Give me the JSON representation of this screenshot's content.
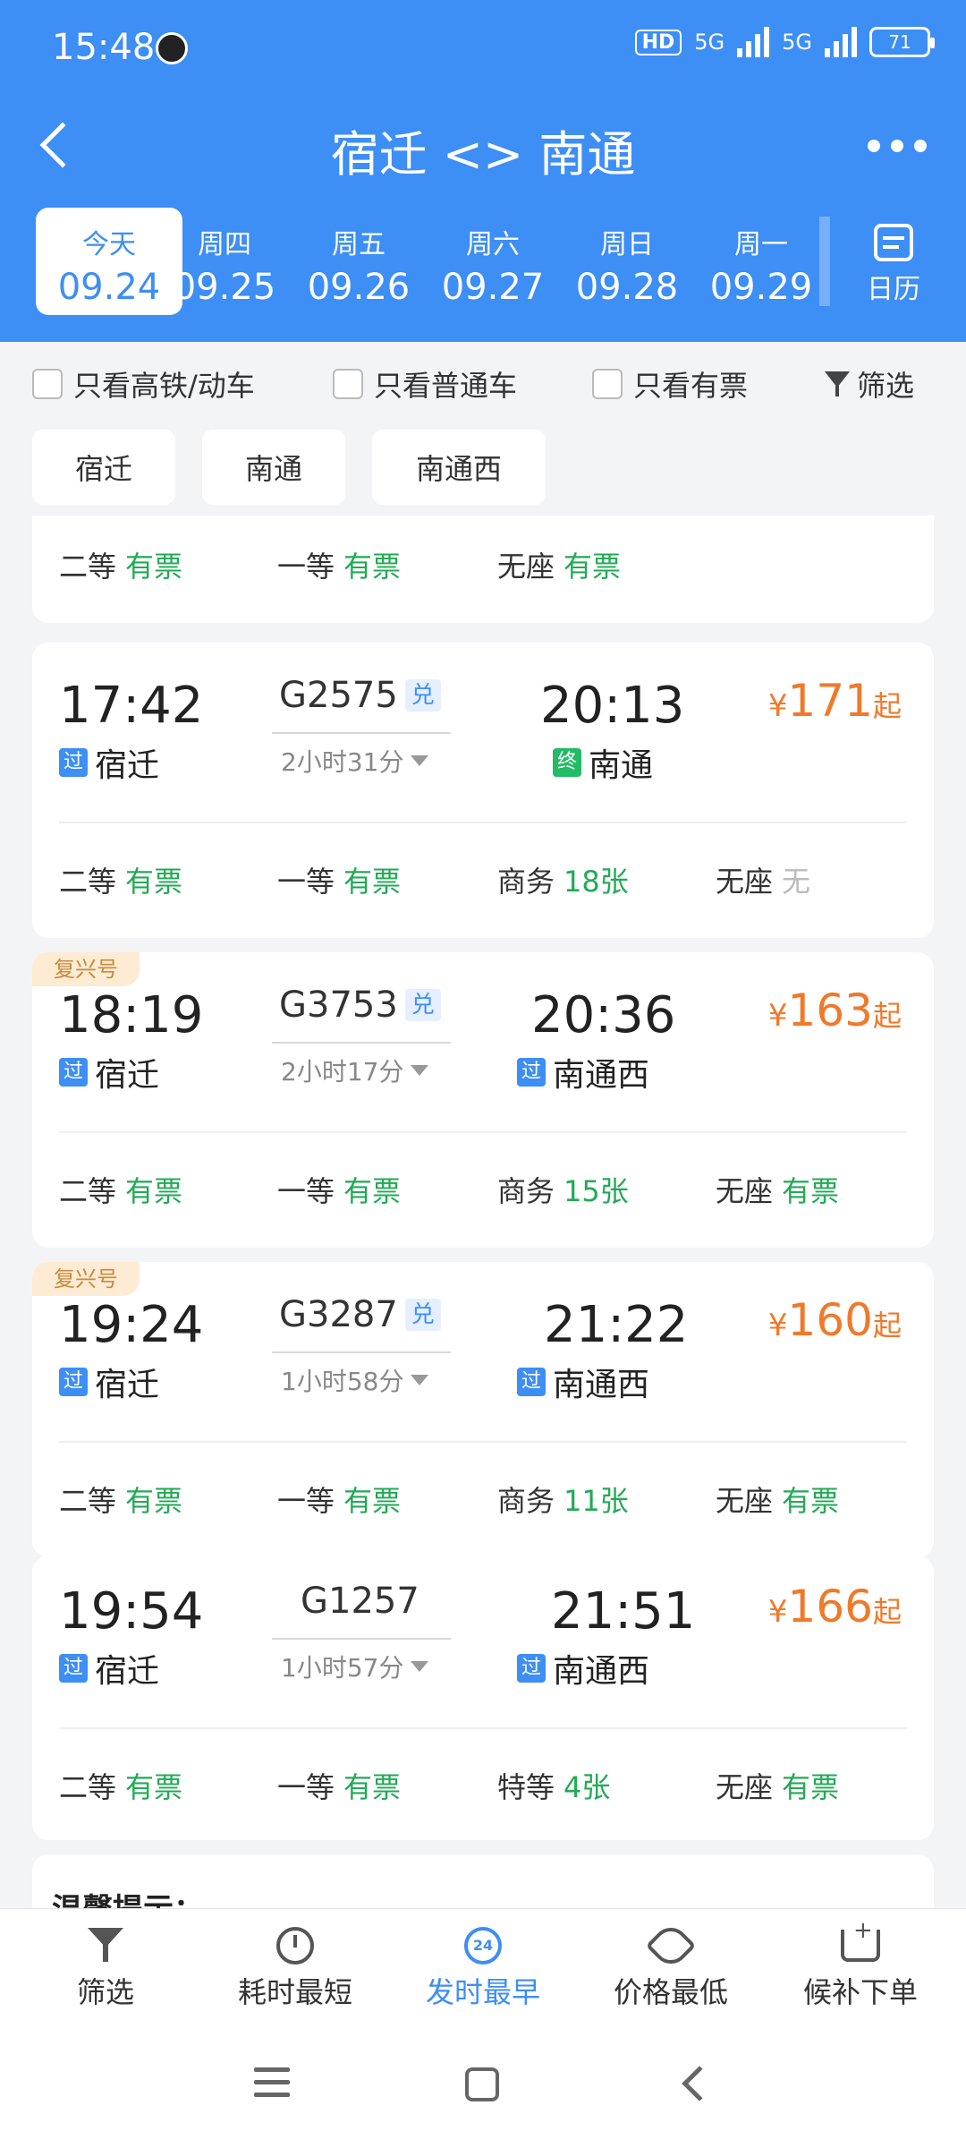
{
  "status_bar": {
    "time": "15:48",
    "hd": "HD",
    "net1": "5G",
    "net2": "5G",
    "battery": "71"
  },
  "nav": {
    "title": "宿迁 <> 南通"
  },
  "dates": [
    {
      "week": "今天",
      "date": "09.24"
    },
    {
      "week": "周四",
      "date": "09.25"
    },
    {
      "week": "周五",
      "date": "09.26"
    },
    {
      "week": "周六",
      "date": "09.27"
    },
    {
      "week": "周日",
      "date": "09.28"
    },
    {
      "week": "周一",
      "date": "09.29"
    }
  ],
  "calendar_label": "日历",
  "filters": {
    "high_speed": "只看高铁/动车",
    "normal": "只看普通车",
    "available": "只看有票",
    "filter": "筛选"
  },
  "stations": [
    "宿迁",
    "南通",
    "南通西"
  ],
  "top_partial": {
    "seats": [
      {
        "name": "二等",
        "value": "有票"
      },
      {
        "name": "一等",
        "value": "有票"
      },
      {
        "name": "无座",
        "value": "有票"
      }
    ]
  },
  "trains": [
    {
      "badge": "",
      "dep_time": "17:42",
      "dep_tag": "过",
      "dep_station": "宿迁",
      "train_no": "G2575",
      "dui": "兑",
      "duration": "2小时31分",
      "arr_time": "20:13",
      "arr_tag": "终",
      "arr_station": "南通",
      "price_cur": "¥",
      "price": "171",
      "price_suffix": "起",
      "seats": [
        {
          "name": "二等",
          "value": "有票"
        },
        {
          "name": "一等",
          "value": "有票"
        },
        {
          "name": "商务",
          "value": "18张"
        },
        {
          "name": "无座",
          "value": "无"
        }
      ]
    },
    {
      "badge": "复兴号",
      "dep_time": "18:19",
      "dep_tag": "过",
      "dep_station": "宿迁",
      "train_no": "G3753",
      "dui": "兑",
      "duration": "2小时17分",
      "arr_time": "20:36",
      "arr_tag": "过",
      "arr_station": "南通西",
      "price_cur": "¥",
      "price": "163",
      "price_suffix": "起",
      "seats": [
        {
          "name": "二等",
          "value": "有票"
        },
        {
          "name": "一等",
          "value": "有票"
        },
        {
          "name": "商务",
          "value": "15张"
        },
        {
          "name": "无座",
          "value": "有票"
        }
      ]
    },
    {
      "badge": "复兴号",
      "dep_time": "19:24",
      "dep_tag": "过",
      "dep_station": "宿迁",
      "train_no": "G3287",
      "dui": "兑",
      "duration": "1小时58分",
      "arr_time": "21:22",
      "arr_tag": "过",
      "arr_station": "南通西",
      "price_cur": "¥",
      "price": "160",
      "price_suffix": "起",
      "seats": [
        {
          "name": "二等",
          "value": "有票"
        },
        {
          "name": "一等",
          "value": "有票"
        },
        {
          "name": "商务",
          "value": "11张"
        },
        {
          "name": "无座",
          "value": "有票"
        }
      ]
    },
    {
      "badge": "",
      "dep_time": "19:54",
      "dep_tag": "过",
      "dep_station": "宿迁",
      "train_no": "G1257",
      "dui": "",
      "duration": "1小时57分",
      "arr_time": "21:51",
      "arr_tag": "过",
      "arr_station": "南通西",
      "price_cur": "¥",
      "price": "166",
      "price_suffix": "起",
      "seats": [
        {
          "name": "二等",
          "value": "有票"
        },
        {
          "name": "一等",
          "value": "有票"
        },
        {
          "name": "特等",
          "value": "4张"
        },
        {
          "name": "无座",
          "value": "有票"
        }
      ]
    }
  ],
  "tips_title": "温馨提示：",
  "tabs": [
    {
      "label": "筛选",
      "icon": "funnel-icon"
    },
    {
      "label": "耗时最短",
      "icon": "timer-icon"
    },
    {
      "label": "发时最早",
      "icon": "clock-24-icon",
      "icon_text": "24"
    },
    {
      "label": "价格最低",
      "icon": "price-tag-icon"
    },
    {
      "label": "候补下单",
      "icon": "cart-icon"
    }
  ],
  "colors": {
    "brand": "#3d8ef5",
    "available": "#22aa55",
    "price": "#f0792a",
    "fuxing_badge_bg": "#fdebd3"
  }
}
